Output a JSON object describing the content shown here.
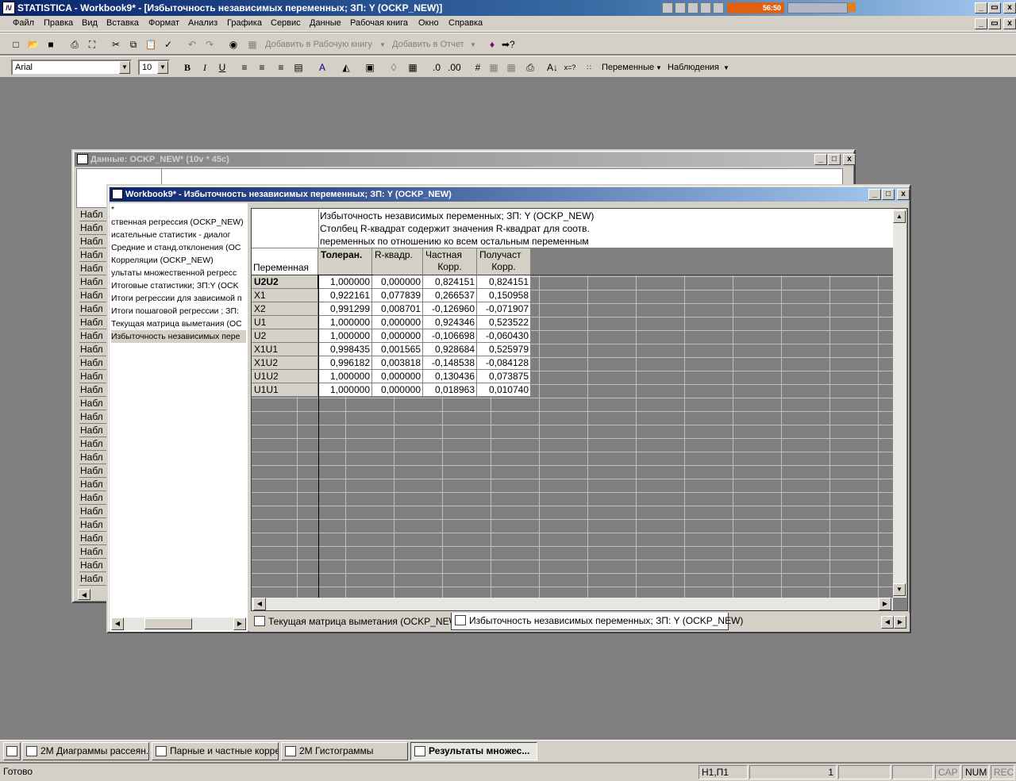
{
  "app": {
    "title": "STATISTICA - Workbook9* - [Избыточность независимых переменных; ЗП: Y (OCKP_NEW)]",
    "media_display": "56:50"
  },
  "menu": [
    "Файл",
    "Правка",
    "Вид",
    "Вставка",
    "Формат",
    "Анализ",
    "Графика",
    "Сервис",
    "Данные",
    "Рабочая книга",
    "Окно",
    "Справка"
  ],
  "toolbar1": {
    "add_to_workbook": "Добавить в Рабочую книгу",
    "add_to_report": "Добавить в Отчет"
  },
  "toolbar2": {
    "font_name": "Arial",
    "font_size": "10",
    "variables": "Переменные",
    "observations": "Наблюдения"
  },
  "data_window": {
    "title": "Данные: OCKP_NEW* (10v * 45c)",
    "row_label": "Набл"
  },
  "workbook_window": {
    "title": "Workbook9* - Избыточность независимых переменных; ЗП: Y (OCKP_NEW)",
    "tree_root": "*",
    "tree_items": [
      "ственная регрессия (OCKP_NEW)",
      "исательные статистик - диалог",
      "Средние и станд.отклонения (OC",
      "Корреляции (OCKP_NEW)",
      "ультаты множественной регресс",
      "Итоговые статистики; ЗП:Y (OCK",
      " Итоги регрессии для зависимой п",
      "Итоги пошаговой регрессии ; ЗП:",
      "Текущая матрица выметания (OC",
      "Избыточность независимых пере"
    ],
    "sheet": {
      "header_lines": [
        "Избыточность независимых переменных; ЗП: Y (OCKP_NEW)",
        "Столбец R-квадрат содержит значения R-квадрат для соотв.",
        "переменных по отношению ко всем остальным переменным"
      ],
      "row_header_title": "Переменная",
      "columns": [
        {
          "l1": "Толеран.",
          "l2": ""
        },
        {
          "l1": "R-квадр.",
          "l2": ""
        },
        {
          "l1": "Частная",
          "l2": "Корр."
        },
        {
          "l1": "Получаст",
          "l2": "Корр."
        }
      ],
      "rows": [
        {
          "name": "U2U2",
          "vals": [
            "1,000000",
            "0,000000",
            "0,824151",
            "0,824151"
          ]
        },
        {
          "name": "X1",
          "vals": [
            "0,922161",
            "0,077839",
            "0,266537",
            "0,150958"
          ]
        },
        {
          "name": "X2",
          "vals": [
            "0,991299",
            "0,008701",
            "-0,126960",
            "-0,071907"
          ]
        },
        {
          "name": "U1",
          "vals": [
            "1,000000",
            "0,000000",
            "0,924346",
            "0,523522"
          ]
        },
        {
          "name": "U2",
          "vals": [
            "1,000000",
            "0,000000",
            "-0,106698",
            "-0,060430"
          ]
        },
        {
          "name": "X1U1",
          "vals": [
            "0,998435",
            "0,001565",
            "0,928684",
            "0,525979"
          ]
        },
        {
          "name": "X1U2",
          "vals": [
            "0,996182",
            "0,003818",
            "-0,148538",
            "-0,084128"
          ]
        },
        {
          "name": "U1U2",
          "vals": [
            "1,000000",
            "0,000000",
            "0,130436",
            "0,073875"
          ]
        },
        {
          "name": "U1U1",
          "vals": [
            "1,000000",
            "0,000000",
            "0,018963",
            "0,010740"
          ]
        }
      ]
    },
    "tabs": [
      "Текущая матрица выметания (OCKP_NEW)",
      "Избыточность независимых переменных; ЗП: Y (OCKP_NEW)"
    ]
  },
  "taskbar": [
    "2M Диаграммы рассеян...",
    "Парные и частные корре...",
    "2M Гистограммы",
    "Результаты множес..."
  ],
  "status": {
    "ready": "Готово",
    "cell_ref": "H1,П1",
    "count": "1",
    "cap": "CAP",
    "num": "NUM",
    "rec": "REC"
  }
}
